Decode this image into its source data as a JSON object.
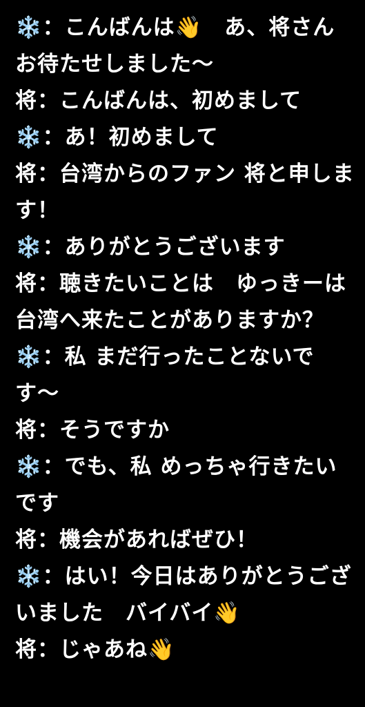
{
  "lines": [
    "❄️：こんばんは👋　あ、将さん　お待たせしました〜",
    "将：こんばんは、初めまして",
    "❄️：あ！初めまして",
    "将：台湾からのファン 将と申します！",
    "❄️：ありがとうございます",
    "将：聴きたいことは　ゆっきーは台湾へ来たことがありますか？",
    "❄️：私 まだ行ったことないです〜",
    "将：そうですか",
    "❄️：でも、私 めっちゃ行きたいです",
    "将：機会があればぜひ！",
    "❄️：はい！今日はありがとうございました　バイバイ👋",
    "将：じゃあね👋"
  ]
}
